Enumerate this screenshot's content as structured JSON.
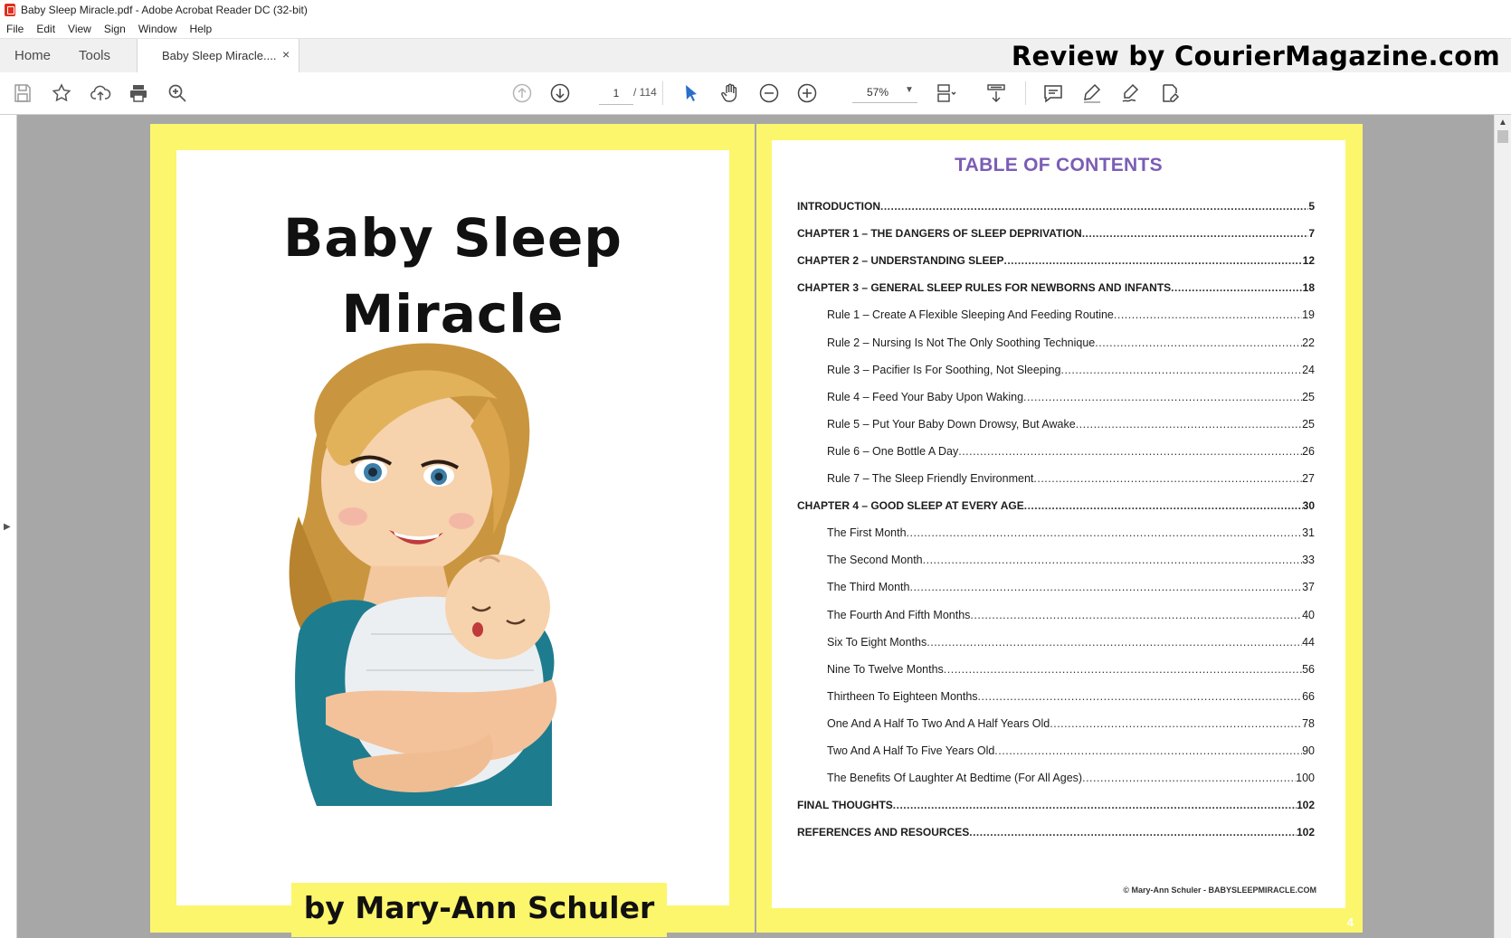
{
  "window": {
    "title": "Baby Sleep Miracle.pdf - Adobe Acrobat Reader DC (32-bit)"
  },
  "menu": [
    "File",
    "Edit",
    "View",
    "Sign",
    "Window",
    "Help"
  ],
  "tabs": {
    "home": "Home",
    "tools": "Tools",
    "document": "Baby Sleep Miracle....",
    "close": "×"
  },
  "watermark": "Review by CourierMagazine.com",
  "toolbar": {
    "page_current": "1",
    "page_total": "/ 114",
    "zoom": "57%",
    "icons": [
      "save-icon",
      "bookmark-star-icon",
      "upload-cloud-icon",
      "print-icon",
      "find-zoom-icon",
      "previous-page-icon",
      "next-page-icon",
      "select-cursor-icon",
      "hand-icon",
      "zoom-out-icon",
      "zoom-in-icon",
      "page-display-icon",
      "scroll-mode-icon",
      "comment-icon",
      "highlight-pen-icon",
      "sign-icon",
      "fill-sign-icon"
    ]
  },
  "colors": {
    "cover_yellow": "#fcf66c",
    "toc_title": "#7b5db5",
    "viewer_bg": "#a7a7a7"
  },
  "cover": {
    "title_line1": "Baby Sleep",
    "title_line2": "Miracle",
    "author": "by Mary-Ann Schuler"
  },
  "toc": {
    "title": "TABLE OF CONTENTS",
    "entries": [
      {
        "label": "INTRODUCTION",
        "page": "5",
        "level": "main"
      },
      {
        "label": "CHAPTER 1 – THE DANGERS OF SLEEP DEPRIVATION",
        "page": "7",
        "level": "main"
      },
      {
        "label": "CHAPTER 2 – UNDERSTANDING SLEEP",
        "page": "12",
        "level": "main"
      },
      {
        "label": "CHAPTER 3 – GENERAL SLEEP RULES FOR NEWBORNS AND INFANTS",
        "page": "18",
        "level": "main"
      },
      {
        "label": "Rule 1 – Create A Flexible Sleeping And Feeding Routine",
        "page": "19",
        "level": "sub"
      },
      {
        "label": "Rule 2 – Nursing Is Not The Only Soothing Technique",
        "page": "22",
        "level": "sub"
      },
      {
        "label": "Rule 3 – Pacifier Is For Soothing, Not Sleeping",
        "page": "24",
        "level": "sub"
      },
      {
        "label": "Rule 4 – Feed Your Baby Upon Waking",
        "page": "25",
        "level": "sub"
      },
      {
        "label": "Rule 5 – Put Your Baby Down Drowsy, But Awake",
        "page": "25",
        "level": "sub"
      },
      {
        "label": "Rule 6 – One Bottle A Day",
        "page": "26",
        "level": "sub"
      },
      {
        "label": "Rule 7 – The Sleep Friendly Environment",
        "page": "27",
        "level": "sub"
      },
      {
        "label": "CHAPTER 4 – GOOD SLEEP AT EVERY AGE",
        "page": "30",
        "level": "main"
      },
      {
        "label": "The First Month",
        "page": "31",
        "level": "sub"
      },
      {
        "label": "The Second Month",
        "page": "33",
        "level": "sub"
      },
      {
        "label": "The Third Month",
        "page": "37",
        "level": "sub"
      },
      {
        "label": "The Fourth And Fifth Months",
        "page": "40",
        "level": "sub"
      },
      {
        "label": "Six To Eight Months",
        "page": "44",
        "level": "sub"
      },
      {
        "label": "Nine To Twelve Months",
        "page": "56",
        "level": "sub"
      },
      {
        "label": "Thirtheen To Eighteen Months",
        "page": "66",
        "level": "sub"
      },
      {
        "label": "One And A Half To Two And A Half Years Old",
        "page": "78",
        "level": "sub"
      },
      {
        "label": "Two And A Half To Five Years Old",
        "page": "90",
        "level": "sub"
      },
      {
        "label": "The Benefits Of Laughter At Bedtime (For All Ages)",
        "page": "100",
        "level": "sub"
      },
      {
        "label": "FINAL THOUGHTS",
        "page": "102",
        "level": "main"
      },
      {
        "label": "REFERENCES AND RESOURCES",
        "page": "102",
        "level": "main"
      }
    ],
    "footer": "© Mary-Ann Schuler - BABYSLEEPMIRACLE.COM",
    "page_number": "4"
  }
}
